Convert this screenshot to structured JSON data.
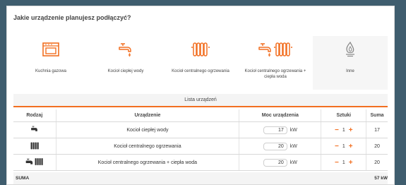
{
  "question": "Jakie urządzenie planujesz podłączyć?",
  "devices": [
    {
      "label": "Kuchnia gazowa",
      "icon": "gas-stove-icon"
    },
    {
      "label": "Kocioł ciepłej wody",
      "icon": "faucet-icon"
    },
    {
      "label": "Kocioł centralnego ogrzewania",
      "icon": "radiator-icon"
    },
    {
      "label": "Kocioł centralnego ogrzewania + ciepła woda",
      "icon": "faucet-radiator-icon"
    },
    {
      "label": "Inne",
      "icon": "flame-icon"
    }
  ],
  "list_title": "Lista urządzeń",
  "table": {
    "headers": {
      "rodzaj": "Rodzaj",
      "urzadzenie": "Urządzenie",
      "moc": "Moc urządzenia",
      "sztuki": "Sztuki",
      "suma": "Suma"
    },
    "rows": [
      {
        "icon": "faucet-icon",
        "name": "Kocioł ciepłej wody",
        "moc": "17",
        "unit": "kW",
        "qty": "1",
        "minus": "−",
        "plus": "+",
        "suma": "17"
      },
      {
        "icon": "radiator-icon",
        "name": "Kocioł centralnego ogrzewania",
        "moc": "20",
        "unit": "kW",
        "qty": "1",
        "minus": "−",
        "plus": "+",
        "suma": "20"
      },
      {
        "icon": "faucet-radiator-icon",
        "name": "Kocioł centralnego ogrzewania + ciepła woda",
        "moc": "20",
        "unit": "kW",
        "qty": "1",
        "minus": "−",
        "plus": "+",
        "suma": "20"
      }
    ]
  },
  "total": {
    "label": "SUMA",
    "value": "57 kW"
  },
  "colors": {
    "accent": "#f26f21",
    "background": "#3f5d6e",
    "panel": "#ffffff"
  }
}
